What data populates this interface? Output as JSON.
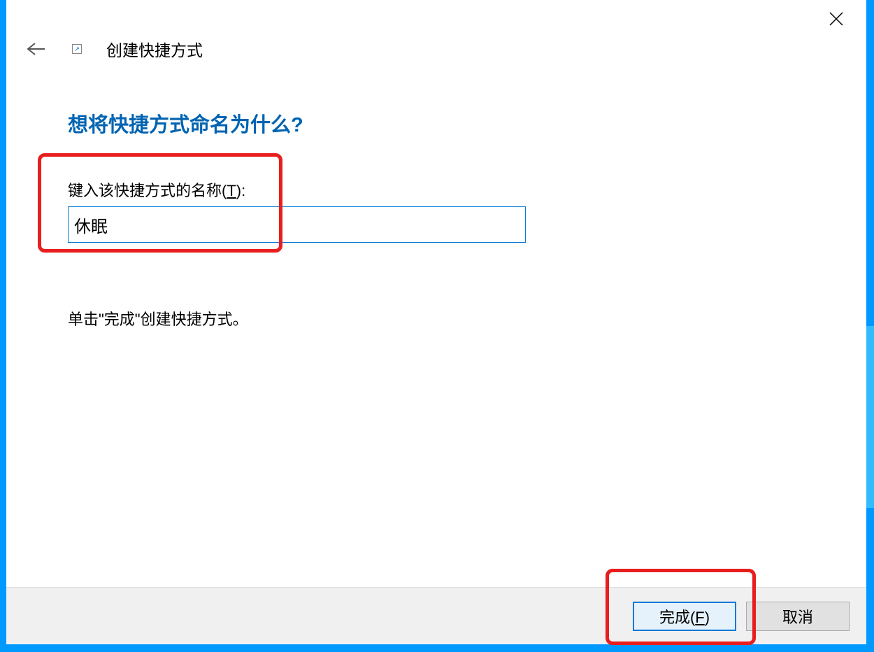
{
  "dialog": {
    "title": "创建快捷方式",
    "heading": "想将快捷方式命名为什么?",
    "input_label_prefix": "键入该快捷方式的名称(",
    "input_label_hotkey": "T",
    "input_label_suffix": "):",
    "input_value": "休眠",
    "instruction": "单击\"完成\"创建快捷方式。",
    "finish_button_prefix": "完成(",
    "finish_button_hotkey": "F",
    "finish_button_suffix": ")",
    "cancel_button": "取消"
  }
}
